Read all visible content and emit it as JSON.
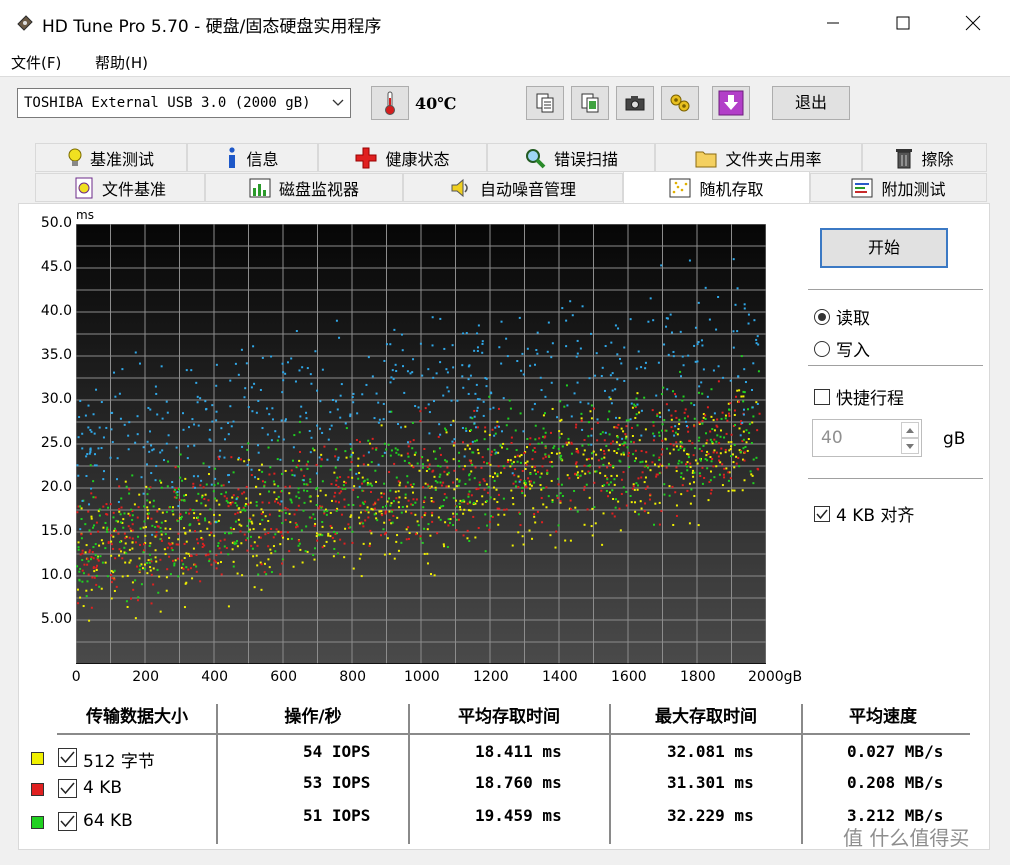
{
  "window": {
    "title": "HD Tune Pro 5.70 - 硬盘/固态硬盘实用程序",
    "minimize_icon": "minimize-icon",
    "maximize_icon": "maximize-icon",
    "close_icon": "close-icon"
  },
  "menu": {
    "file": "文件(F)",
    "help": "帮助(H)"
  },
  "toolbar": {
    "drive": "TOSHIBA External USB 3.0 (2000 gB)",
    "temperature": "40℃",
    "exit": "退出",
    "icons": [
      "copy-icon",
      "copy-screen-icon",
      "camera-icon",
      "options-icon",
      "download-icon"
    ]
  },
  "tabs_row1": [
    {
      "label": "基准测试",
      "icon": "bulb-icon"
    },
    {
      "label": "信息",
      "icon": "info-icon"
    },
    {
      "label": "健康状态",
      "icon": "health-cross-icon"
    },
    {
      "label": "错误扫描",
      "icon": "magnifier-icon"
    },
    {
      "label": "文件夹占用率",
      "icon": "folder-icon"
    },
    {
      "label": "擦除",
      "icon": "trash-icon"
    }
  ],
  "tabs_row2": [
    {
      "label": "文件基准",
      "icon": "file-bench-icon"
    },
    {
      "label": "磁盘监视器",
      "icon": "monitor-chart-icon"
    },
    {
      "label": "自动噪音管理",
      "icon": "speaker-icon"
    },
    {
      "label": "随机存取",
      "icon": "random-access-icon",
      "active": true
    },
    {
      "label": "附加测试",
      "icon": "extra-tests-icon"
    }
  ],
  "chart_data": {
    "type": "scatter",
    "ylabel": "ms",
    "xlabel": "",
    "y_ticks": [
      "50.0",
      "45.0",
      "40.0",
      "35.0",
      "30.0",
      "25.0",
      "20.0",
      "15.0",
      "10.0",
      "5.00"
    ],
    "x_ticks": [
      "0",
      "200",
      "400",
      "600",
      "800",
      "1000",
      "1200",
      "1400",
      "1600",
      "1800",
      "2000gB"
    ],
    "xlim": [
      0,
      2000
    ],
    "ylim": [
      0,
      50
    ],
    "grid": true,
    "series": [
      {
        "name": "512 字节",
        "color": "#f0f000",
        "trend": {
          "x": [
            0,
            1000,
            2000
          ],
          "y": [
            12,
            19,
            25
          ]
        }
      },
      {
        "name": "4 KB",
        "color": "#e02020",
        "trend": {
          "x": [
            0,
            1000,
            2000
          ],
          "y": [
            13,
            20,
            26
          ]
        }
      },
      {
        "name": "64 KB",
        "color": "#20d020",
        "trend": {
          "x": [
            0,
            1000,
            2000
          ],
          "y": [
            14,
            21,
            27
          ]
        }
      },
      {
        "name": "",
        "color": "#30a8e8",
        "trend": {
          "x": [
            0,
            1000,
            2000
          ],
          "y": [
            24,
            31,
            36
          ]
        }
      }
    ]
  },
  "side": {
    "start": "开始",
    "read": "读取",
    "write": "写入",
    "short_stroke": "快捷行程",
    "stroke_value": "40",
    "stroke_unit": "gB",
    "align": "4 KB 对齐"
  },
  "table": {
    "headers": [
      "传输数据大小",
      "操作/秒",
      "平均存取时间",
      "最大存取时间",
      "平均速度"
    ],
    "rows": [
      {
        "color": "#f0f000",
        "label": "512 字节",
        "iops": "54 IOPS",
        "avg": "18.411 ms",
        "max": "32.081 ms",
        "speed": "0.027 MB/s"
      },
      {
        "color": "#e02020",
        "label": "4 KB",
        "iops": "53 IOPS",
        "avg": "18.760 ms",
        "max": "31.301 ms",
        "speed": "0.208 MB/s"
      },
      {
        "color": "#20d020",
        "label": "64 KB",
        "iops": "51 IOPS",
        "avg": "19.459 ms",
        "max": "32.229 ms",
        "speed": "3.212 MB/s"
      }
    ]
  },
  "watermark": "值 什么值得买"
}
